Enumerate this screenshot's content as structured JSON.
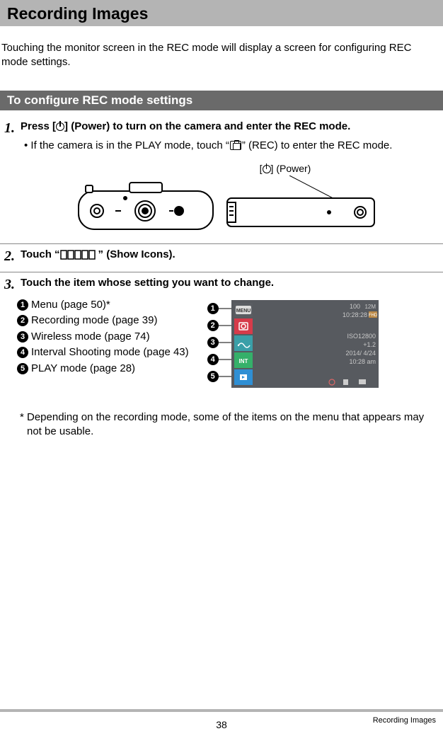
{
  "heading": "Recording Images",
  "intro": "Touching the monitor screen in the REC mode will display a screen for configuring REC mode settings.",
  "subheading": "To configure REC mode settings",
  "steps": {
    "s1": {
      "num": "1.",
      "text_a": "Press [",
      "text_b": "] (Power) to turn on the camera and enter the REC mode.",
      "sub_a": "If the camera is in the PLAY mode, touch “",
      "sub_b": "” (REC) to enter the REC mode."
    },
    "power_label_a": "[",
    "power_label_b": "] (Power)",
    "s2": {
      "num": "2.",
      "text_a": "Touch “",
      "text_b": "” (Show Icons)."
    },
    "s3": {
      "num": "3.",
      "text": "Touch the item whose setting you want to change."
    }
  },
  "callouts": [
    {
      "n": "1",
      "label": "Menu (page 50)",
      "suffix": "*"
    },
    {
      "n": "2",
      "label": "Recording mode (page 39)",
      "suffix": ""
    },
    {
      "n": "3",
      "label": "Wireless mode (page 74)",
      "suffix": ""
    },
    {
      "n": "4",
      "label": "Interval Shooting mode (page 43)",
      "suffix": ""
    },
    {
      "n": "5",
      "label": "PLAY mode (page 28)",
      "suffix": ""
    }
  ],
  "screenshot": {
    "top_right_1": "100",
    "top_right_2": "12M",
    "time": "10:28:28",
    "fhd": "FHD",
    "iso": "ISO12800",
    "ev": "+1.2",
    "date": "2014/  4/24",
    "clock": "10:28 am",
    "menu_label": "MENU",
    "int_label": "INT"
  },
  "note": "* Depending on the recording mode, some of the items on the menu that appears may not be usable.",
  "footer": {
    "page": "38",
    "title": "Recording Images"
  }
}
